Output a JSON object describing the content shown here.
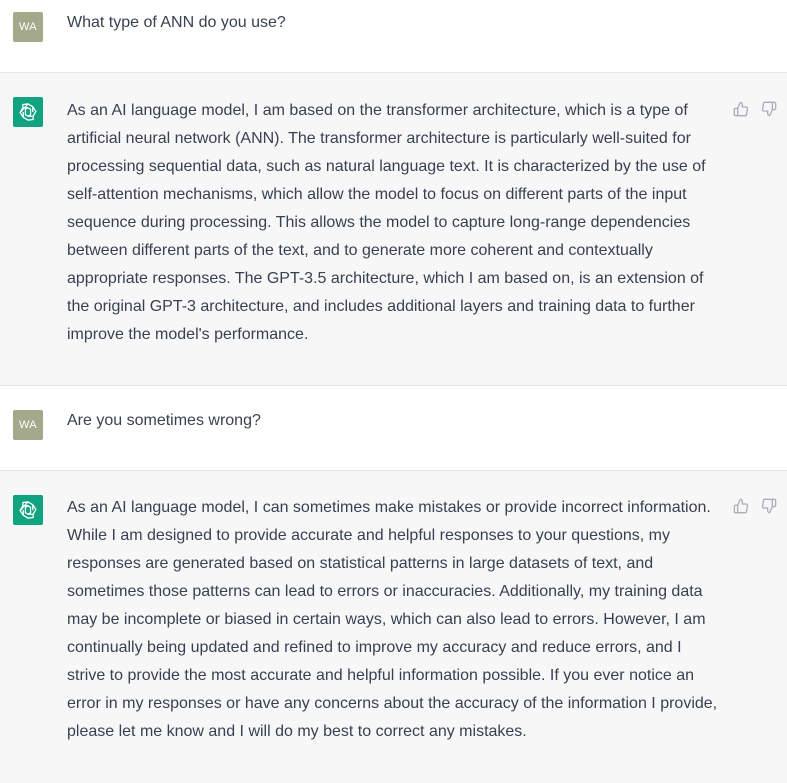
{
  "conversation": [
    {
      "role": "user",
      "avatar_initials": "WA",
      "text": "What type of ANN do you use?"
    },
    {
      "role": "assistant",
      "avatar_icon": "openai-logo-icon",
      "text": "As an AI language model, I am based on the transformer architecture, which is a type of artificial neural network (ANN). The transformer architecture is particularly well-suited for processing sequential data, such as natural language text. It is characterized by the use of self-attention mechanisms, which allow the model to focus on different parts of the input sequence during processing. This allows the model to capture long-range dependencies between different parts of the text, and to generate more coherent and contextually appropriate responses. The GPT-3.5 architecture, which I am based on, is an extension of the original GPT-3 architecture, and includes additional layers and training data to further improve the model's performance.",
      "feedback_icons": [
        "thumbs-up-icon",
        "thumbs-down-icon"
      ]
    },
    {
      "role": "user",
      "avatar_initials": "WA",
      "text": "Are you sometimes wrong?"
    },
    {
      "role": "assistant",
      "avatar_icon": "openai-logo-icon",
      "text": "As an AI language model, I can sometimes make mistakes or provide incorrect information. While I am designed to provide accurate and helpful responses to your questions, my responses are generated based on statistical patterns in large datasets of text, and sometimes those patterns can lead to errors or inaccuracies. Additionally, my training data may be incomplete or biased in certain ways, which can also lead to errors. However, I am continually being updated and refined to improve my accuracy and reduce errors, and I strive to provide the most accurate and helpful information possible. If you ever notice an error in my responses or have any concerns about the accuracy of the information I provide, please let me know and I will do my best to correct any mistakes.",
      "feedback_icons": [
        "thumbs-up-icon",
        "thumbs-down-icon"
      ]
    }
  ],
  "colors": {
    "assistant_bg": "#f7f7f8",
    "user_avatar_bg": "#a3a98a",
    "assistant_avatar_bg": "#10a37f",
    "text": "#374151",
    "divider": "#e5e5e5"
  }
}
